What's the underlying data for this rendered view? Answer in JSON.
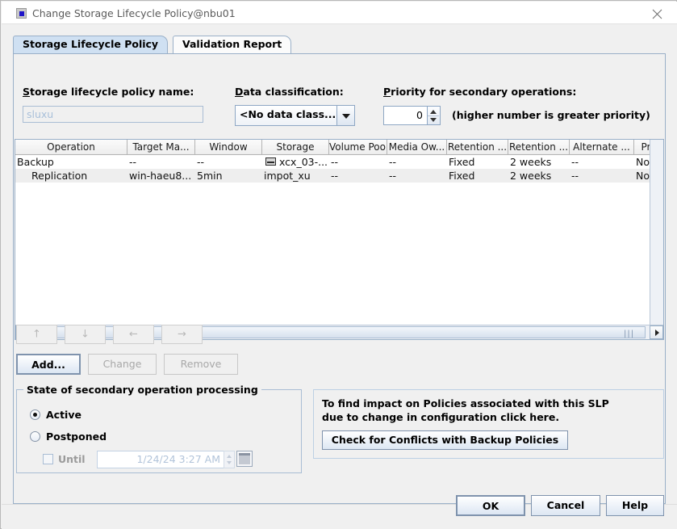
{
  "window": {
    "title": "Change Storage Lifecycle Policy@nbu01",
    "icon": "app-icon",
    "close_icon": "close-icon"
  },
  "tabs": [
    {
      "label": "Storage Lifecycle Policy",
      "selected": true
    },
    {
      "label": "Validation Report",
      "selected": false
    }
  ],
  "form": {
    "policy_name_label": "Storage lifecycle policy name:",
    "policy_name_mnemonic": "S",
    "policy_name_value": "sluxu",
    "data_classification_label": "Data classification:",
    "data_classification_mnemonic": "D",
    "data_classification_value": "<No data class...",
    "priority_label": "Priority for secondary operations:",
    "priority_mnemonic": "P",
    "priority_value": "0",
    "priority_hint": "(higher number is greater priority)"
  },
  "table": {
    "columns": [
      "Operation",
      "Target Ma...",
      "Window",
      "Storage",
      "Volume Pool",
      "Media Ow...",
      "Retention ...",
      "Retention ...",
      "Alternate ...",
      "Pre"
    ],
    "rows": [
      {
        "operation": "Backup",
        "target_master": "--",
        "window": "--",
        "storage": "xcx_03-...",
        "storage_icon": "disk-storage-icon",
        "volume_pool": "--",
        "media_owner": "--",
        "retention_type": "Fixed",
        "retention_period": "2 weeks",
        "alternate_read_server": "--",
        "preserve": "No",
        "indent": false
      },
      {
        "operation": "Replication",
        "target_master": "win-haeu8...",
        "window": "5min",
        "storage": "impot_xu",
        "storage_icon": "",
        "volume_pool": "--",
        "media_owner": "--",
        "retention_type": "Fixed",
        "retention_period": "2 weeks",
        "alternate_read_server": "--",
        "preserve": "No",
        "indent": true
      }
    ]
  },
  "move_buttons": [
    {
      "name": "move-up",
      "glyph": "↑"
    },
    {
      "name": "move-down",
      "glyph": "↓"
    },
    {
      "name": "move-left",
      "glyph": "←"
    },
    {
      "name": "move-right",
      "glyph": "→"
    }
  ],
  "actions": {
    "add_label": "Add...",
    "change_label": "Change",
    "remove_label": "Remove"
  },
  "state_group": {
    "title": "State of secondary operation processing",
    "active_label": "Active",
    "postponed_label": "Postponed",
    "until_label": "Until",
    "until_value": "1/24/24 3:27 AM",
    "calendar_icon": "calendar-icon",
    "active_selected": true,
    "postponed_selected": false,
    "until_checked": false
  },
  "conflicts_panel": {
    "text": "To find impact on Policies associated with this SLP\ndue to change in configuration click here.",
    "button_label": "Check for Conflicts with Backup Policies"
  },
  "footer": {
    "ok_label": "OK",
    "cancel_label": "Cancel",
    "help_label": "Help"
  },
  "colors": {
    "dialog_bg": "#f0f0f0",
    "tab_selected": "#cfe0f2",
    "border_blue": "#9ab0c8",
    "row_alt": "#eeeeee",
    "disabled_text": "#a8a8a8"
  }
}
